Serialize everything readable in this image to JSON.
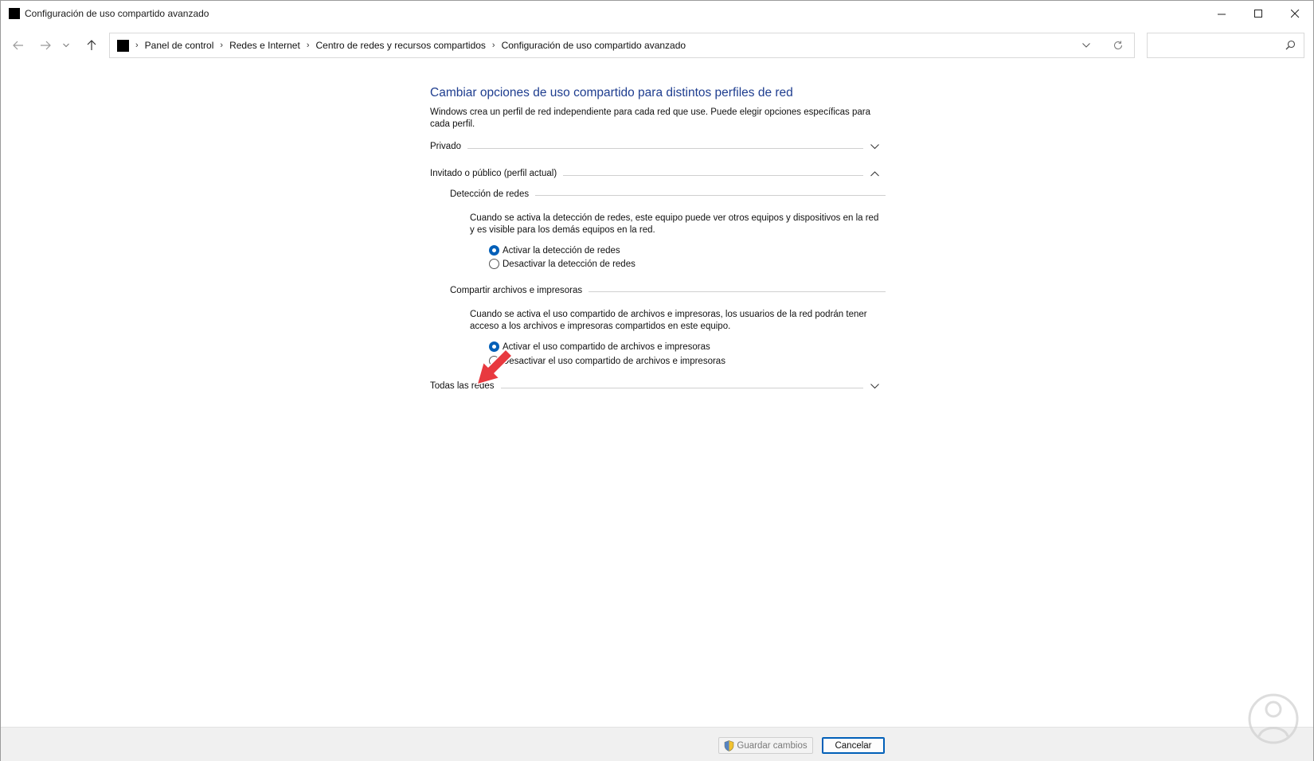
{
  "window": {
    "title": "Configuración de uso compartido avanzado",
    "controls": [
      "minimize",
      "maximize",
      "close"
    ]
  },
  "navbar": {
    "breadcrumbs": [
      "Panel de control",
      "Redes e Internet",
      "Centro de redes y recursos compartidos",
      "Configuración de uso compartido avanzado"
    ],
    "search_placeholder": ""
  },
  "main": {
    "heading": "Cambiar opciones de uso compartido para distintos perfiles de red",
    "description": "Windows crea un perfil de red independiente para cada red que use. Puede elegir opciones específicas para cada perfil.",
    "profiles": [
      {
        "label": "Privado",
        "expanded": false
      },
      {
        "label": "Invitado o público (perfil actual)",
        "expanded": true
      },
      {
        "label": "Todas las redes",
        "expanded": false
      }
    ],
    "network_discovery": {
      "title": "Detección de redes",
      "text": "Cuando se activa la detección de redes, este equipo puede ver otros equipos y dispositivos en la red y es visible para los demás equipos en la red.",
      "options": [
        "Activar la detección de redes",
        "Desactivar la detección de redes"
      ],
      "selected": 0
    },
    "file_sharing": {
      "title": "Compartir archivos e impresoras",
      "text": "Cuando se activa el uso compartido de archivos e impresoras, los usuarios de la red podrán tener acceso a los archivos e impresoras compartidos en este equipo.",
      "options": [
        "Activar el uso compartido de archivos e impresoras",
        "Desactivar el uso compartido de archivos e impresoras"
      ],
      "selected": 0
    }
  },
  "footer": {
    "save_label": "Guardar cambios",
    "cancel_label": "Cancelar"
  },
  "colors": {
    "heading": "#1e3d8f",
    "accent": "#005fb8",
    "annotation_arrow": "#e8393f"
  },
  "icons": [
    "back-arrow-icon",
    "forward-arrow-icon",
    "recent-dropdown-icon",
    "up-arrow-icon",
    "refresh-icon",
    "search-icon",
    "chevron-down-icon",
    "chevron-up-icon",
    "shield-icon"
  ]
}
